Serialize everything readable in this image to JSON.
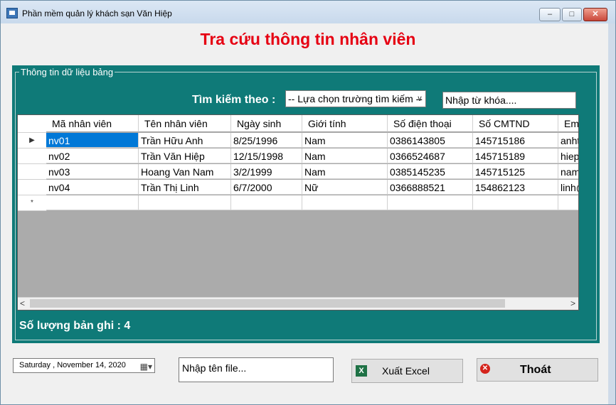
{
  "window": {
    "title": "Phần mềm quản lý khách sạn Văn Hiệp",
    "minimize_glyph": "–",
    "maximize_glyph": "□",
    "close_glyph": "✕"
  },
  "heading": "Tra cứu thông tin nhân viên",
  "panel": {
    "legend": "Thông tin dữ liệu  bảng",
    "search_label": "Tìm kiếm theo :",
    "field_select": "-- Lựa chọn trường tìm kiếm --",
    "keyword_input": "Nhập từ khóa....",
    "count_label": "Số lượng bản ghi : 4"
  },
  "grid": {
    "columns": [
      "Mã nhân viên",
      "Tên nhân viên",
      "Ngày sinh",
      "Giới tính",
      "Số điện thoại",
      "Số CMTND",
      "Email"
    ],
    "rows": [
      {
        "marker": "▶",
        "cells": [
          "nv01",
          "Trần Hữu Anh",
          "8/25/1996",
          "Nam",
          "0386143805",
          "145715186",
          "anhtran@gmail.com"
        ]
      },
      {
        "marker": "",
        "cells": [
          "nv02",
          "Trần Văn Hiệp",
          "12/15/1998",
          "Nam",
          "0366524687",
          "145715189",
          "hiep@gmail.com"
        ]
      },
      {
        "marker": "",
        "cells": [
          "nv03",
          "Hoang Van Nam",
          "3/2/1999",
          "Nam",
          "0385145235",
          "145715125",
          "nam@gmail.com"
        ]
      },
      {
        "marker": "",
        "cells": [
          "nv04",
          "Trần Thị Linh",
          "6/7/2000",
          "Nữ",
          "0366888521",
          "154862123",
          "linh@gmail.com"
        ]
      },
      {
        "marker": "*",
        "cells": [
          "",
          "",
          "",
          "",
          "",
          "",
          ""
        ]
      }
    ],
    "selected_row": 0,
    "selected_col": 0
  },
  "footer": {
    "date": "Saturday   , November 14, 2020",
    "filename_input": "Nhập tên file...",
    "excel_button": "Xuất Excel",
    "exit_button": "Thoát"
  },
  "colors": {
    "heading": "#e60012",
    "panel": "#0f7a78",
    "selection": "#0078d7"
  }
}
